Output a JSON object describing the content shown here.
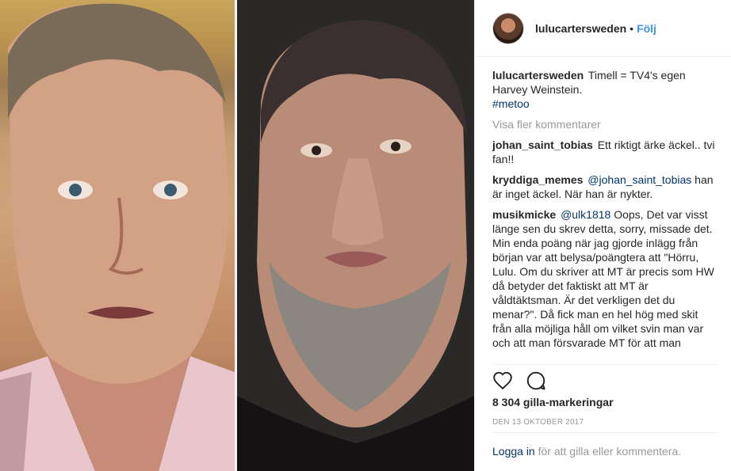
{
  "post": {
    "username": "lulucartersweden",
    "separator": "•",
    "follow_label": "Följ",
    "caption_author": "lulucartersweden",
    "caption_text": "Timell = TV4's egen Harvey Weinstein.",
    "caption_hashtag": "#metoo",
    "load_more_label": "Visa fler kommentarer",
    "comments": [
      {
        "author": "johan_saint_tobias",
        "mention": "",
        "text": "Ett riktigt ärke äckel.. tvi fan!!"
      },
      {
        "author": "kryddiga_memes",
        "mention": "@johan_saint_tobias",
        "text": "han är inget äckel. När han är nykter."
      },
      {
        "author": "musikmicke",
        "mention": "@ulk1818",
        "text": "Oops, Det var visst länge sen du skrev detta, sorry, missade det. Min enda poäng när jag gjorde inlägg från början var att belysa/poängtera att \"Hörru, Lulu. Om du skriver att MT är precis som HW då betyder det faktiskt att MT är våldtäktsman. Är det verkligen det du menar?\". Då fick man en hel hög med skit från alla möjliga håll om vilket svin man var och att man försvarade MT för att man"
      }
    ],
    "likes": "8 304 gilla-markeringar",
    "date": "DEN 13 OKTOBER 2017",
    "login_link": "Logga in",
    "login_text": " för att gilla eller kommentera."
  },
  "icons": {
    "like": "heart-icon",
    "comment": "comment-icon"
  },
  "colors": {
    "link_blue": "#3897f0",
    "dark_link": "#003569",
    "muted": "#999999",
    "text": "#262626"
  }
}
